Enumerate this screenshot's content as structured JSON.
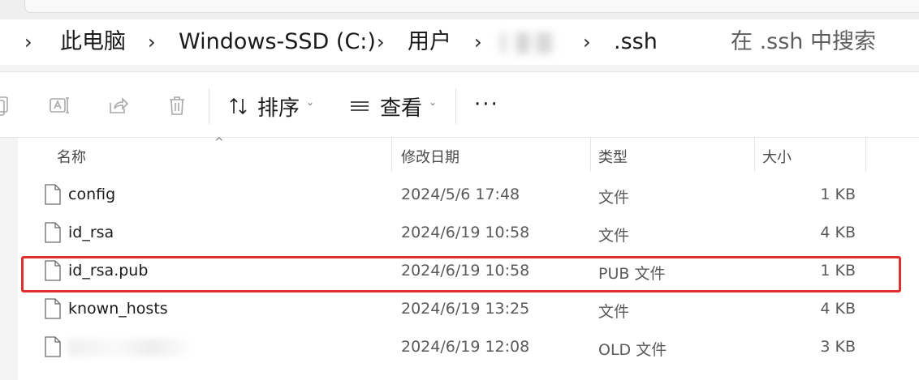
{
  "breadcrumb": {
    "items": [
      "此电脑",
      "Windows-SSD (C:)",
      "用户",
      "",
      ".ssh"
    ]
  },
  "search": {
    "placeholder": "在 .ssh 中搜索"
  },
  "toolbar": {
    "sort_label": "排序",
    "view_label": "查看",
    "more_label": "···",
    "icons": [
      "copy-icon",
      "rename-icon",
      "share-icon",
      "delete-icon",
      "sort-icon",
      "view-icon"
    ]
  },
  "columns": {
    "name": "名称",
    "date": "修改日期",
    "type": "类型",
    "size": "大小"
  },
  "files": [
    {
      "name": "config",
      "date": "2024/5/6 17:48",
      "type": "文件",
      "size": "1 KB"
    },
    {
      "name": "id_rsa",
      "date": "2024/6/19 10:58",
      "type": "文件",
      "size": "4 KB"
    },
    {
      "name": "id_rsa.pub",
      "date": "2024/6/19 10:58",
      "type": "PUB 文件",
      "size": "1 KB"
    },
    {
      "name": "known_hosts",
      "date": "2024/6/19 13:25",
      "type": "文件",
      "size": "4 KB"
    },
    {
      "name": "",
      "date": "2024/6/19 12:08",
      "type": "OLD 文件",
      "size": "3 KB"
    }
  ],
  "highlighted_file": "id_rsa.pub",
  "colors": {
    "highlight": "#e0302c",
    "icon_disabled": "#a8a8a8"
  }
}
